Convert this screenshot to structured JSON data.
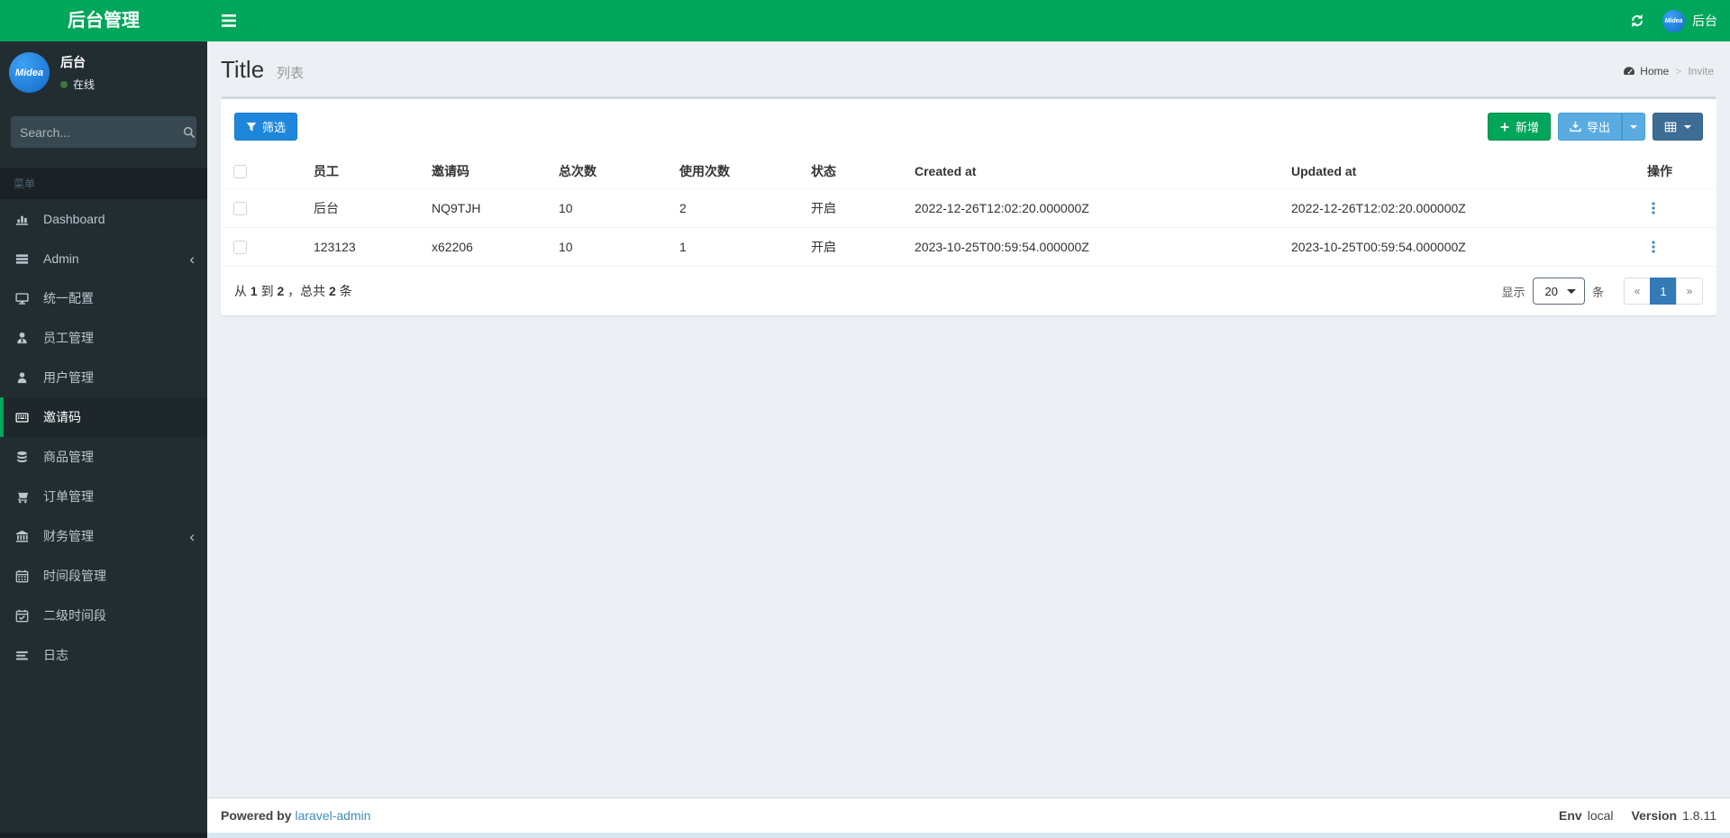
{
  "navbar": {
    "brand": "后台管理",
    "user_name": "后台",
    "avatar_text": "Midea"
  },
  "sidebar": {
    "user": {
      "name": "后台",
      "status": "在线",
      "avatar_text": "Midea"
    },
    "search_placeholder": "Search...",
    "menu_header": "菜单",
    "items": [
      {
        "label": "Dashboard",
        "icon": "bar-chart-icon",
        "active": false,
        "has_children": false
      },
      {
        "label": "Admin",
        "icon": "list-icon",
        "active": false,
        "has_children": true
      },
      {
        "label": "统一配置",
        "icon": "desktop-icon",
        "active": false,
        "has_children": false
      },
      {
        "label": "员工管理",
        "icon": "user-tie-icon",
        "active": false,
        "has_children": false
      },
      {
        "label": "用户管理",
        "icon": "user-icon",
        "active": false,
        "has_children": false
      },
      {
        "label": "邀请码",
        "icon": "keyboard-icon",
        "active": true,
        "has_children": false
      },
      {
        "label": "商品管理",
        "icon": "database-icon",
        "active": false,
        "has_children": false
      },
      {
        "label": "订单管理",
        "icon": "cart-icon",
        "active": false,
        "has_children": false
      },
      {
        "label": "财务管理",
        "icon": "bank-icon",
        "active": false,
        "has_children": true
      },
      {
        "label": "时间段管理",
        "icon": "calendar-icon",
        "active": false,
        "has_children": false
      },
      {
        "label": "二级时间段",
        "icon": "calendar-check-icon",
        "active": false,
        "has_children": false
      },
      {
        "label": "日志",
        "icon": "log-icon",
        "active": false,
        "has_children": false
      }
    ]
  },
  "header": {
    "title": "Title",
    "subtitle": "列表",
    "breadcrumb": {
      "home": "Home",
      "current": "Invite"
    }
  },
  "toolbar": {
    "filter_label": "筛选",
    "add_label": "新增",
    "export_label": "导出"
  },
  "table": {
    "columns": [
      "员工",
      "邀请码",
      "总次数",
      "使用次数",
      "状态",
      "Created at",
      "Updated at",
      "操作"
    ],
    "rows": [
      {
        "staff": "后台",
        "code": "NQ9TJH",
        "total": "10",
        "used": "2",
        "status": "开启",
        "created_at": "2022-12-26T12:02:20.000000Z",
        "updated_at": "2022-12-26T12:02:20.000000Z"
      },
      {
        "staff": "123123",
        "code": "x62206",
        "total": "10",
        "used": "1",
        "status": "开启",
        "created_at": "2023-10-25T00:59:54.000000Z",
        "updated_at": "2023-10-25T00:59:54.000000Z"
      }
    ]
  },
  "table_footer": {
    "summary": {
      "s1": "从",
      "from": "1",
      "s2": "到",
      "to": "2",
      "s3": "，总共",
      "total": "2",
      "s4": "条"
    },
    "per_page_label": "显示",
    "per_page_value": "20",
    "per_page_unit": "条",
    "pagination": {
      "prev": "«",
      "page": "1",
      "next": "»"
    }
  },
  "footer": {
    "powered_by": "Powered by",
    "powered_link": "laravel-admin",
    "env_label": "Env",
    "env_value": "local",
    "version_label": "Version",
    "version_value": "1.8.11"
  },
  "colors": {
    "brand_green": "#00a65a",
    "sidebar_bg": "#222d32",
    "sidebar_active_bg": "#1e282c",
    "content_bg": "#ecf0f5",
    "primary_blue": "#1e87db",
    "export_blue": "#5aabe0",
    "grid_btn_blue": "#3d6d96",
    "pagination_active": "#337ab7",
    "link_blue": "#3c8dbc"
  }
}
